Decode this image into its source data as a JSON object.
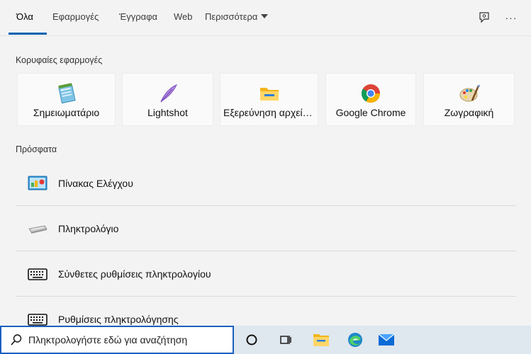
{
  "tabs": [
    {
      "label": "Όλα",
      "active": true
    },
    {
      "label": "Εφαρμογές"
    },
    {
      "label": "Έγγραφα"
    },
    {
      "label": "Web"
    },
    {
      "label": "Περισσότερα"
    }
  ],
  "header_icons": {
    "feedback": "feedback-icon",
    "more": "ellipsis-icon",
    "more_label": "···"
  },
  "sections": {
    "top_apps_title": "Κορυφαίες εφαρμογές",
    "recent_title": "Πρόσφατα"
  },
  "top_apps": [
    {
      "label": "Σημειωματάριο",
      "icon": "notepad-icon"
    },
    {
      "label": "Lightshot",
      "icon": "lightshot-feather-icon"
    },
    {
      "label": "Εξερεύνηση αρχείων",
      "icon": "folder-icon"
    },
    {
      "label": "Google Chrome",
      "icon": "chrome-icon"
    },
    {
      "label": "Ζωγραφική",
      "icon": "paint-palette-icon"
    }
  ],
  "recent": [
    {
      "label": "Πίνακας Ελέγχου",
      "icon": "control-panel-icon"
    },
    {
      "label": "Πληκτρολόγιο",
      "icon": "keyboard-flat-icon"
    },
    {
      "label": "Σύνθετες ρυθμίσεις πληκτρολογίου",
      "icon": "keyboard-icon"
    },
    {
      "label": "Ρυθμίσεις πληκτρολόγησης",
      "icon": "keyboard-icon"
    }
  ],
  "taskbar": {
    "search_text": "Πληκτρολογήστε εδώ για αναζήτηση",
    "icons": [
      "cortana-circle-icon",
      "task-view-icon",
      "file-explorer-icon",
      "edge-icon",
      "mail-icon"
    ]
  },
  "colors": {
    "accent": "#0063b1",
    "taskbar_bg": "#dfe7ef",
    "panel_bg": "#f3f3f3"
  }
}
